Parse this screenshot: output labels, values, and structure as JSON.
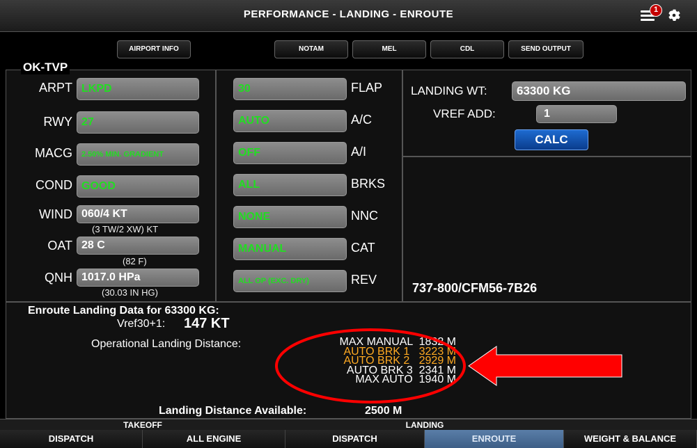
{
  "header": {
    "title": "PERFORMANCE - LANDING - ENROUTE",
    "notification_count": "1"
  },
  "toolbar": {
    "airport_info": "AIRPORT INFO",
    "notam": "NOTAM",
    "mel": "MEL",
    "cdl": "CDL",
    "send_output": "SEND OUTPUT"
  },
  "aircraft_reg": "OK-TVP",
  "left": {
    "arpt": {
      "label": "ARPT",
      "value": "LKPD"
    },
    "rwy": {
      "label": "RWY",
      "value": "27"
    },
    "macg": {
      "label": "MACG",
      "value": "2.50% MIN. GRADIENT"
    },
    "cond": {
      "label": "COND",
      "value": "GOOD"
    },
    "wind": {
      "label": "WIND",
      "value": "060/4 KT",
      "sub": "(3 TW/2 XW) KT"
    },
    "oat": {
      "label": "OAT",
      "value": "28 C",
      "sub": "(82 F)"
    },
    "qnh": {
      "label": "QNH",
      "value": "1017.0 HPa",
      "sub": "(30.03 IN HG)"
    }
  },
  "middle": {
    "flap": {
      "label": "FLAP",
      "value": "30"
    },
    "ac": {
      "label": "A/C",
      "value": "AUTO"
    },
    "ai": {
      "label": "A/I",
      "value": "OFF"
    },
    "brks": {
      "label": "BRKS",
      "value": "ALL"
    },
    "nnc": {
      "label": "NNC",
      "value": "NONE"
    },
    "cat": {
      "label": "CAT",
      "value": "MANUAL"
    },
    "rev": {
      "label": "REV",
      "value": "ALL OP (EXC. DRY)"
    }
  },
  "right": {
    "landing_wt_label": "LANDING WT:",
    "landing_wt_value": "63300 KG",
    "vref_add_label": "VREF ADD:",
    "vref_add_value": "1",
    "calc": "CALC",
    "model": "737-800/CFM56-7B26"
  },
  "results": {
    "heading": "Enroute Landing Data for 63300 KG:",
    "vref_label": "Vref30+1:",
    "vref_value": "147 KT",
    "ld_label": "Operational Landing Distance:",
    "rows": [
      {
        "text": "MAX MANUAL  1832 M",
        "highlight": false
      },
      {
        "text": "AUTO BRK 1   3223 M",
        "highlight": true
      },
      {
        "text": "AUTO BRK 2   2929 M",
        "highlight": true
      },
      {
        "text": "AUTO BRK 3  2341 M",
        "highlight": false
      },
      {
        "text": "MAX AUTO  1940 M",
        "highlight": false
      }
    ],
    "lda_label": "Landing Distance Available:",
    "lda_value": "2500 M"
  },
  "groups": {
    "takeoff": "TAKEOFF",
    "landing": "LANDING"
  },
  "tabs": [
    "DISPATCH",
    "ALL ENGINE",
    "DISPATCH",
    "ENROUTE",
    "WEIGHT & BALANCE"
  ],
  "colors": {
    "green_value": "#22dd22",
    "highlight": "#ffaa22",
    "annotation": "#ff0000",
    "active_tab": "#4a6e98"
  }
}
